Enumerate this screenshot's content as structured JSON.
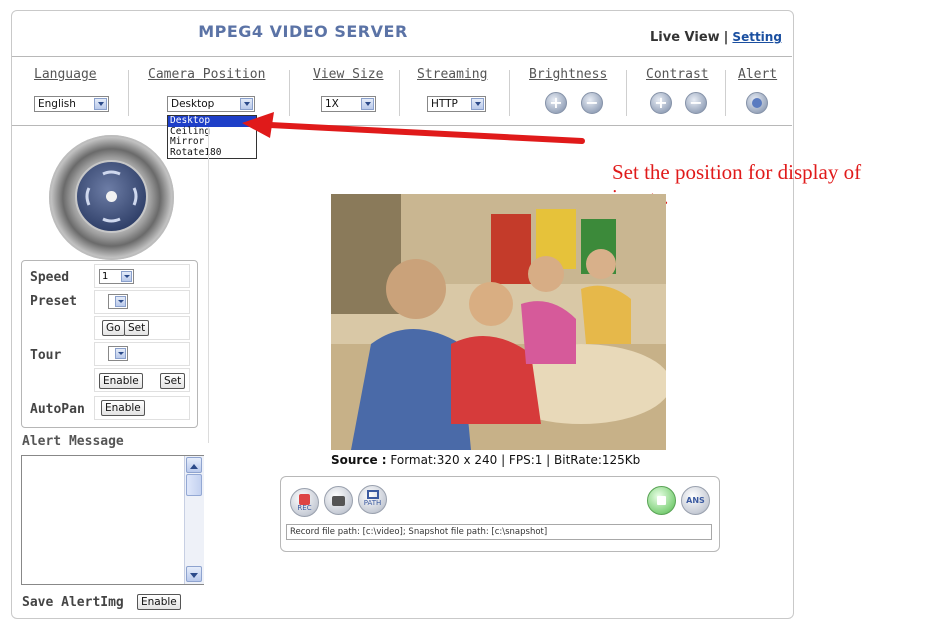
{
  "header": {
    "title": "MPEG4 VIDEO SERVER",
    "nav_live": "Live View",
    "nav_separator": "|",
    "nav_setting": "Setting"
  },
  "toolbar": {
    "language": {
      "label": "Language",
      "value": "English"
    },
    "camera_position": {
      "label": "Camera Position",
      "value": "Desktop",
      "options": [
        "Desktop",
        "Ceiling",
        "Mirror",
        "Rotate180"
      ],
      "selected_index": 0
    },
    "view_size": {
      "label": "View Size",
      "value": "1X"
    },
    "streaming": {
      "label": "Streaming",
      "value": "HTTP"
    },
    "brightness": {
      "label": "Brightness"
    },
    "contrast": {
      "label": "Contrast"
    },
    "alert": {
      "label": "Alert"
    }
  },
  "annotation": {
    "line1": "Set the position for display of",
    "line2": "image.",
    "color": "#e01a1a"
  },
  "ptz": {
    "speed_label": "Speed",
    "speed_value": "1",
    "preset_label": "Preset",
    "preset_value": "",
    "go_label": "Go",
    "set_label": "Set",
    "tour_label": "Tour",
    "tour_value": "",
    "tour_enable_label": "Enable",
    "tour_set_label": "Set",
    "autopan_label": "AutoPan",
    "autopan_enable_label": "Enable"
  },
  "alerts": {
    "title": "Alert Message",
    "save_label": "Save AlertImg",
    "save_enable_label": "Enable"
  },
  "video": {
    "source_label": "Source :",
    "source_info": " Format:320 x 240 | FPS:1 | BitRate:125Kb"
  },
  "recording": {
    "rec_label": "REC",
    "path_label": "PATH",
    "ans_label": "ANS",
    "path_text": "Record file path: [c:\\video]; Snapshot file path: [c:\\snapshot]"
  }
}
